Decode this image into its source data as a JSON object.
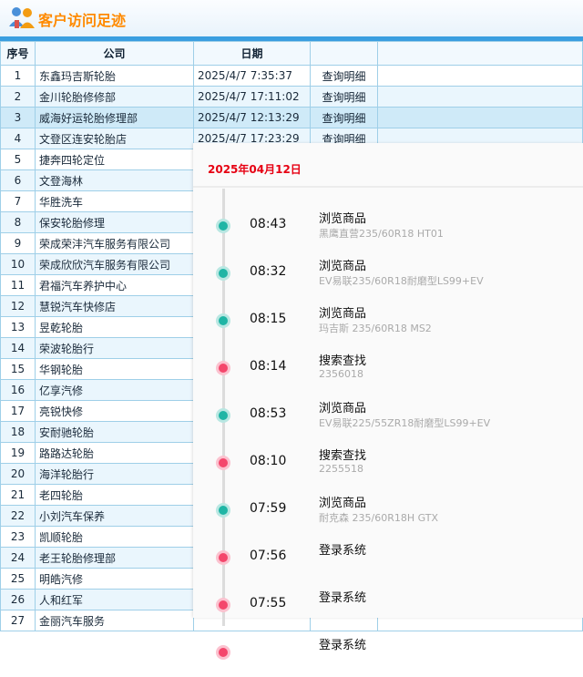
{
  "header": {
    "title": "客户访问足迹"
  },
  "table": {
    "columns": [
      "序号",
      "公司",
      "日期",
      ""
    ],
    "action_label": "查询明细",
    "rows": [
      {
        "no": "1",
        "company": "东鑫玛吉斯轮胎",
        "date": "2025/4/7 7:35:37"
      },
      {
        "no": "2",
        "company": "金川轮胎修修部",
        "date": "2025/4/7 17:11:02"
      },
      {
        "no": "3",
        "company": "威海好运轮胎修理部",
        "date": "2025/4/7 12:13:29"
      },
      {
        "no": "4",
        "company": "文登区连安轮胎店",
        "date": "2025/4/7 17:23:29"
      },
      {
        "no": "5",
        "company": "捷奔四轮定位",
        "date": ""
      },
      {
        "no": "6",
        "company": "文登海林",
        "date": ""
      },
      {
        "no": "7",
        "company": "华胜洗车",
        "date": ""
      },
      {
        "no": "8",
        "company": "保安轮胎修理",
        "date": ""
      },
      {
        "no": "9",
        "company": "荣成荣沣汽车服务有限公司",
        "date": ""
      },
      {
        "no": "10",
        "company": "荣成欣欣汽车服务有限公司",
        "date": ""
      },
      {
        "no": "11",
        "company": "君福汽车养护中心",
        "date": ""
      },
      {
        "no": "12",
        "company": "慧锐汽车快修店",
        "date": ""
      },
      {
        "no": "13",
        "company": "昱乾轮胎",
        "date": ""
      },
      {
        "no": "14",
        "company": "荣波轮胎行",
        "date": ""
      },
      {
        "no": "15",
        "company": "华钢轮胎",
        "date": ""
      },
      {
        "no": "16",
        "company": "亿享汽修",
        "date": ""
      },
      {
        "no": "17",
        "company": "亮锐快修",
        "date": ""
      },
      {
        "no": "18",
        "company": "安耐驰轮胎",
        "date": ""
      },
      {
        "no": "19",
        "company": "路路达轮胎",
        "date": ""
      },
      {
        "no": "20",
        "company": "海洋轮胎行",
        "date": ""
      },
      {
        "no": "21",
        "company": "老四轮胎",
        "date": ""
      },
      {
        "no": "22",
        "company": "小刘汽车保养",
        "date": ""
      },
      {
        "no": "23",
        "company": "凯顺轮胎",
        "date": ""
      },
      {
        "no": "24",
        "company": "老王轮胎修理部",
        "date": ""
      },
      {
        "no": "25",
        "company": "明皓汽修",
        "date": ""
      },
      {
        "no": "26",
        "company": "人和红军",
        "date": ""
      },
      {
        "no": "27",
        "company": "金丽汽车服务",
        "date": ""
      }
    ]
  },
  "panel": {
    "date": "2025年04月12日",
    "events": [
      {
        "time": "08:43",
        "action": "浏览商品",
        "detail": "黑鹰直营235/60R18 HT01",
        "type": "teal"
      },
      {
        "time": "08:32",
        "action": "浏览商品",
        "detail": "EV易联235/60R18耐磨型LS99+EV",
        "type": "teal"
      },
      {
        "time": "08:15",
        "action": "浏览商品",
        "detail": "玛吉斯 235/60R18 MS2",
        "type": "teal"
      },
      {
        "time": "08:14",
        "action": "搜索查找",
        "detail": "2356018",
        "type": "pink"
      },
      {
        "time": "08:53",
        "action": "浏览商品",
        "detail": "EV易联225/55ZR18耐磨型LS99+EV",
        "type": "teal"
      },
      {
        "time": "08:10",
        "action": "搜索查找",
        "detail": "2255518",
        "type": "pink"
      },
      {
        "time": "07:59",
        "action": "浏览商品",
        "detail": "耐克森 235/60R18H GTX",
        "type": "teal"
      },
      {
        "time": "07:56",
        "action": "登录系统",
        "detail": "",
        "type": "pink"
      },
      {
        "time": "07:55",
        "action": "登录系统",
        "detail": "",
        "type": "pink"
      },
      {
        "time": "",
        "action": "登录系统",
        "detail": "",
        "type": "pink"
      }
    ]
  },
  "colors": {
    "accent": "#3a9ee0",
    "title": "#ff8a00",
    "date": "#e60012",
    "teal": "#1fb5a5",
    "pink": "#f4476c"
  }
}
